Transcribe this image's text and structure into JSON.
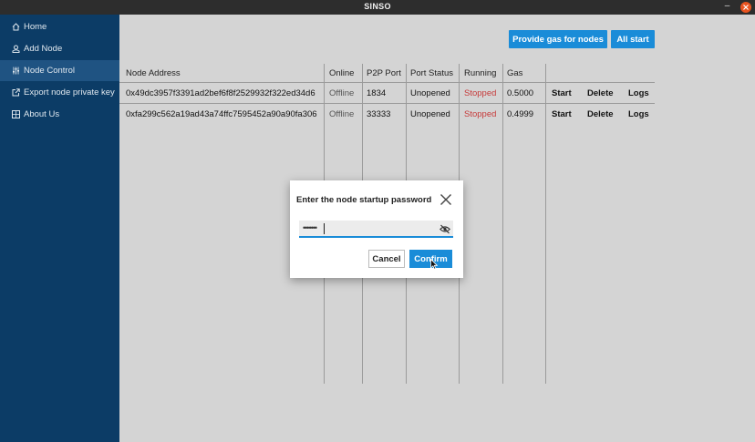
{
  "window": {
    "title": "SINSO",
    "minimize_label": "–"
  },
  "colors": {
    "sidebar": "#0c3c66",
    "sidebar_active": "#1f5382",
    "accent": "#1a8cd8",
    "stopped": "#c63b3b",
    "close": "#e95420"
  },
  "sidebar": {
    "items": [
      {
        "label": "Home",
        "icon": "home-icon"
      },
      {
        "label": "Add Node",
        "icon": "user-add-icon"
      },
      {
        "label": "Node Control",
        "icon": "sliders-icon",
        "active": true
      },
      {
        "label": "Export node private key",
        "icon": "export-icon"
      },
      {
        "label": "About Us",
        "icon": "info-icon"
      }
    ]
  },
  "toolbar": {
    "provide_gas_label": "Provide gas for nodes",
    "all_start_label": "All start"
  },
  "table": {
    "headers": [
      "Node Address",
      "Online",
      "P2P Port",
      "Port Status",
      "Running",
      "Gas"
    ],
    "rows": [
      {
        "address": "0x49dc3957f3391ad2bef6f8f2529932f322ed34d6",
        "online": "Offline",
        "port": "1834",
        "port_status": "Unopened",
        "running": "Stopped",
        "gas": "0.5000",
        "actions": [
          "Start",
          "Delete",
          "Logs"
        ]
      },
      {
        "address": "0xfa299c562a19ad43a74ffc7595452a90a90fa306",
        "online": "Offline",
        "port": "33333",
        "port_status": "Unopened",
        "running": "Stopped",
        "gas": "0.4999",
        "actions": [
          "Start",
          "Delete",
          "Logs"
        ]
      }
    ]
  },
  "dialog": {
    "title": "Enter the node startup password",
    "password_masked": "•••••••",
    "cancel_label": "Cancel",
    "confirm_label": "Confirm"
  }
}
